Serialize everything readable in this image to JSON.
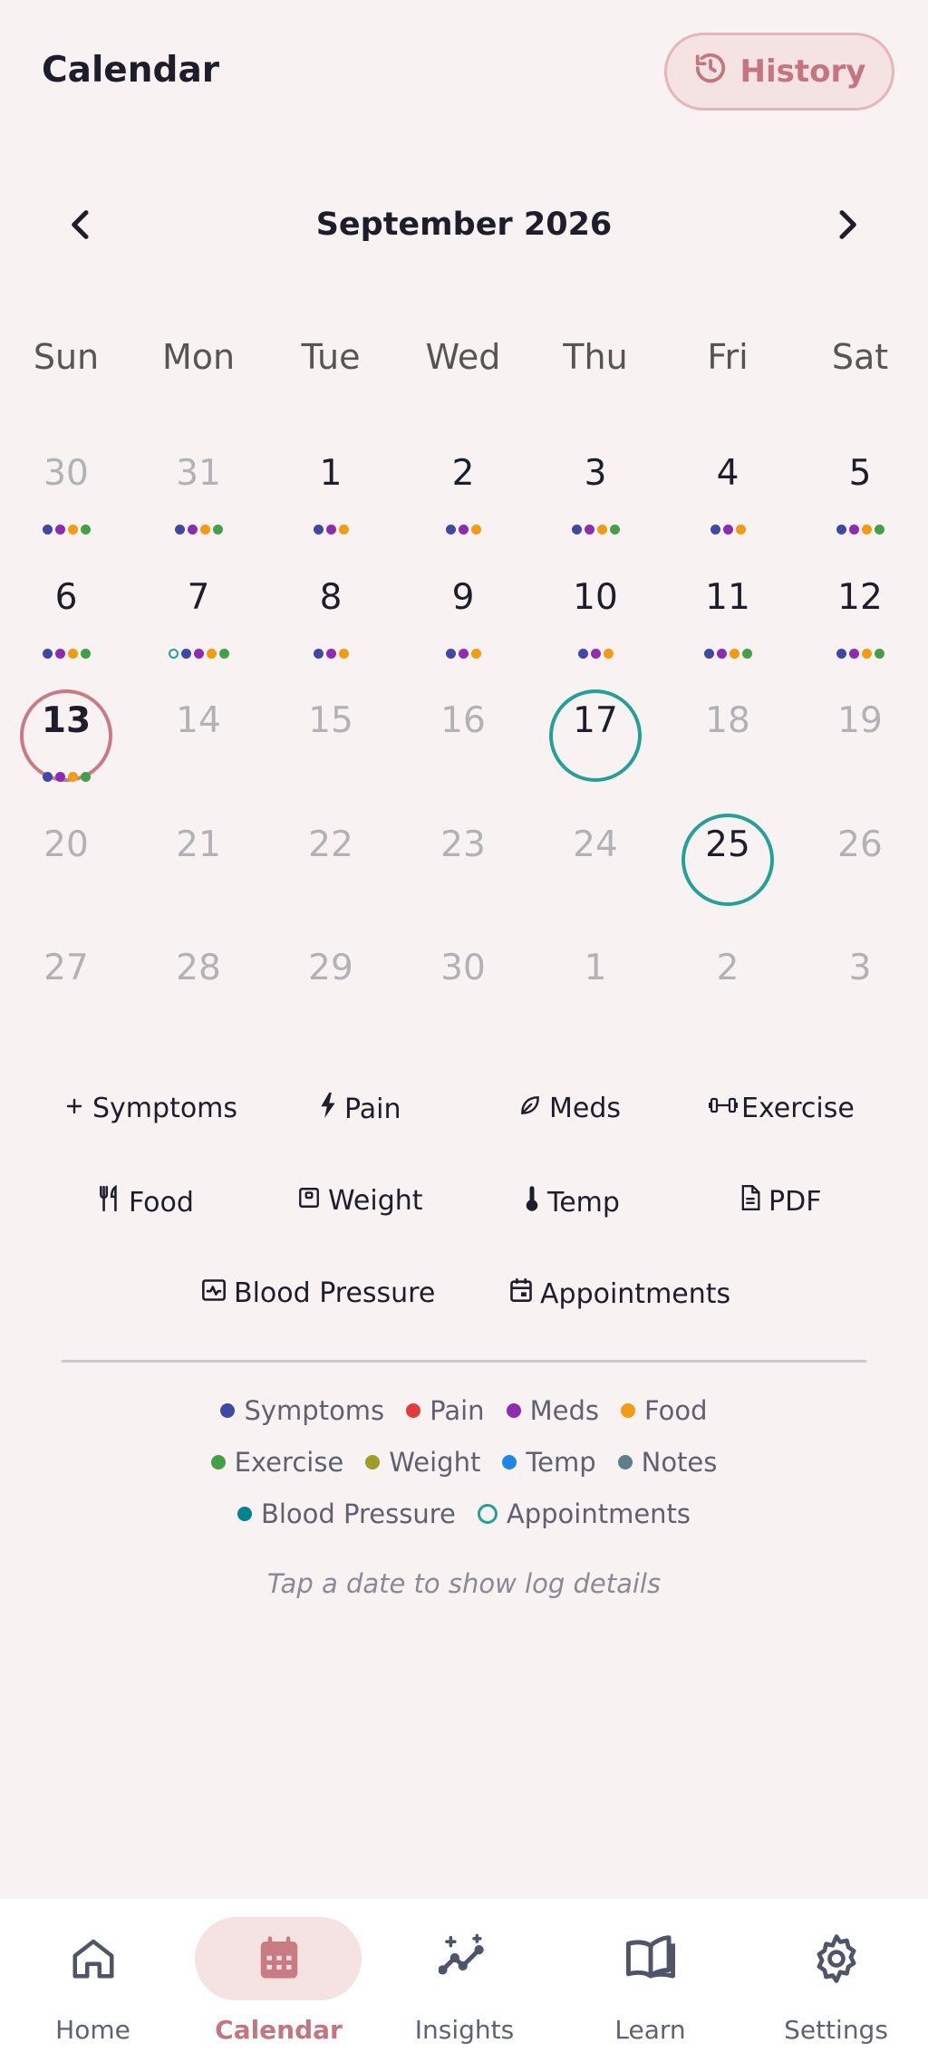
{
  "header": {
    "title": "Calendar",
    "history_label": "History"
  },
  "month": {
    "title": "September 2026"
  },
  "weekdays": [
    "Sun",
    "Mon",
    "Tue",
    "Wed",
    "Thu",
    "Fri",
    "Sat"
  ],
  "colors": {
    "symptoms": "#3f48a5",
    "pain": "#e43a3a",
    "meds": "#8e2bb0",
    "food": "#f39c12",
    "exercise": "#43a047",
    "weight": "#9e9d24",
    "temp": "#1e88e5",
    "notes": "#607d8b",
    "blood_pressure": "#00838f",
    "appointments": "#22a199",
    "today": "#c97b84"
  },
  "days": [
    {
      "n": "30",
      "cur": false,
      "dots": [
        "symptoms",
        "meds",
        "food",
        "exercise"
      ]
    },
    {
      "n": "31",
      "cur": false,
      "dots": [
        "symptoms",
        "meds",
        "food",
        "exercise"
      ]
    },
    {
      "n": "1",
      "cur": true,
      "dots": [
        "symptoms",
        "meds",
        "food"
      ]
    },
    {
      "n": "2",
      "cur": true,
      "dots": [
        "symptoms",
        "meds",
        "food"
      ]
    },
    {
      "n": "3",
      "cur": true,
      "dots": [
        "symptoms",
        "meds",
        "food",
        "exercise"
      ]
    },
    {
      "n": "4",
      "cur": true,
      "dots": [
        "symptoms",
        "meds",
        "food"
      ]
    },
    {
      "n": "5",
      "cur": true,
      "dots": [
        "symptoms",
        "meds",
        "food",
        "exercise"
      ]
    },
    {
      "n": "6",
      "cur": true,
      "dots": [
        "symptoms",
        "meds",
        "food",
        "exercise"
      ]
    },
    {
      "n": "7",
      "cur": true,
      "dots": [
        "appointments",
        "symptoms",
        "meds",
        "food",
        "exercise"
      ]
    },
    {
      "n": "8",
      "cur": true,
      "dots": [
        "symptoms",
        "meds",
        "food"
      ]
    },
    {
      "n": "9",
      "cur": true,
      "dots": [
        "symptoms",
        "meds",
        "food"
      ]
    },
    {
      "n": "10",
      "cur": true,
      "dots": [
        "symptoms",
        "meds",
        "food"
      ]
    },
    {
      "n": "11",
      "cur": true,
      "dots": [
        "symptoms",
        "meds",
        "food",
        "exercise"
      ]
    },
    {
      "n": "12",
      "cur": true,
      "dots": [
        "symptoms",
        "meds",
        "food",
        "exercise"
      ]
    },
    {
      "n": "13",
      "cur": true,
      "today": true,
      "dots": [
        "symptoms",
        "meds",
        "food",
        "exercise"
      ]
    },
    {
      "n": "14",
      "cur": false,
      "dots": []
    },
    {
      "n": "15",
      "cur": false,
      "dots": []
    },
    {
      "n": "16",
      "cur": false,
      "dots": []
    },
    {
      "n": "17",
      "cur": true,
      "appointment": true,
      "dots": []
    },
    {
      "n": "18",
      "cur": false,
      "dots": []
    },
    {
      "n": "19",
      "cur": false,
      "dots": []
    },
    {
      "n": "20",
      "cur": false,
      "dots": []
    },
    {
      "n": "21",
      "cur": false,
      "dots": []
    },
    {
      "n": "22",
      "cur": false,
      "dots": []
    },
    {
      "n": "23",
      "cur": false,
      "dots": []
    },
    {
      "n": "24",
      "cur": false,
      "dots": []
    },
    {
      "n": "25",
      "cur": true,
      "appointment": true,
      "dots": []
    },
    {
      "n": "26",
      "cur": false,
      "dots": []
    },
    {
      "n": "27",
      "cur": false,
      "dots": []
    },
    {
      "n": "28",
      "cur": false,
      "dots": []
    },
    {
      "n": "29",
      "cur": false,
      "dots": []
    },
    {
      "n": "30",
      "cur": false,
      "dots": []
    },
    {
      "n": "1",
      "cur": false,
      "dots": []
    },
    {
      "n": "2",
      "cur": false,
      "dots": []
    },
    {
      "n": "3",
      "cur": false,
      "dots": []
    }
  ],
  "quick_actions": [
    {
      "label": "Symptoms",
      "icon": "plus-icon"
    },
    {
      "label": "Pain",
      "icon": "bolt-icon"
    },
    {
      "label": "Meds",
      "icon": "leaf-icon"
    },
    {
      "label": "Exercise",
      "icon": "dumbbell-icon"
    },
    {
      "label": "Food",
      "icon": "utensils-icon"
    },
    {
      "label": "Weight",
      "icon": "scale-icon"
    },
    {
      "label": "Temp",
      "icon": "thermometer-icon"
    },
    {
      "label": "PDF",
      "icon": "document-icon"
    },
    {
      "label": "Blood Pressure",
      "icon": "heart-monitor-icon"
    },
    {
      "label": "Appointments",
      "icon": "calendar-small-icon"
    }
  ],
  "legend": [
    {
      "label": "Symptoms",
      "key": "symptoms"
    },
    {
      "label": "Pain",
      "key": "pain"
    },
    {
      "label": "Meds",
      "key": "meds"
    },
    {
      "label": "Food",
      "key": "food"
    },
    {
      "label": "Exercise",
      "key": "exercise"
    },
    {
      "label": "Weight",
      "key": "weight"
    },
    {
      "label": "Temp",
      "key": "temp"
    },
    {
      "label": "Notes",
      "key": "notes"
    },
    {
      "label": "Blood Pressure",
      "key": "blood_pressure"
    },
    {
      "label": "Appointments",
      "key": "appointments"
    }
  ],
  "hint": "Tap a date to show log details",
  "bottom_nav": [
    {
      "label": "Home",
      "icon": "home-icon",
      "active": false
    },
    {
      "label": "Calendar",
      "icon": "calendar-icon",
      "active": true
    },
    {
      "label": "Insights",
      "icon": "insights-icon",
      "active": false
    },
    {
      "label": "Learn",
      "icon": "book-icon",
      "active": false
    },
    {
      "label": "Settings",
      "icon": "gear-icon",
      "active": false
    }
  ]
}
